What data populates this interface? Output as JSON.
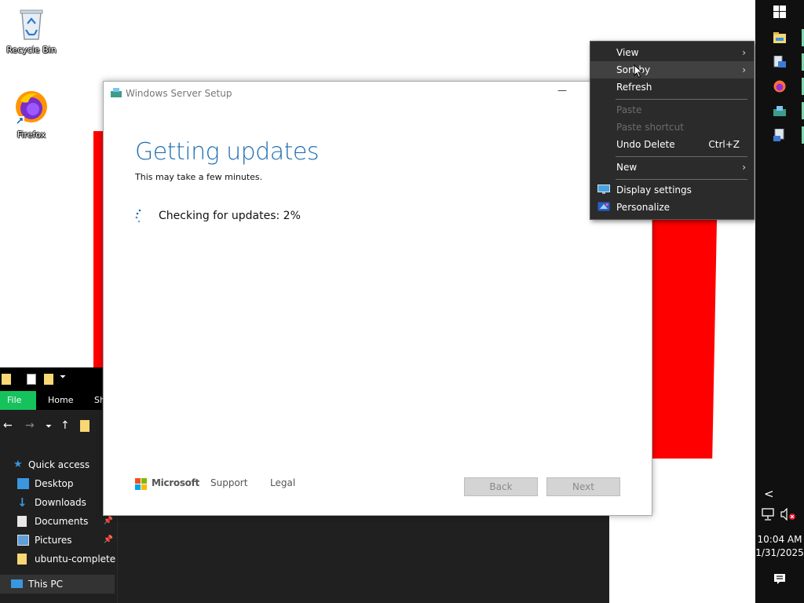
{
  "desktop": {
    "icons": [
      {
        "label": "Recycle Bin",
        "icon": "recycle-bin-icon"
      },
      {
        "label": "Firefox",
        "icon": "firefox-icon"
      }
    ]
  },
  "explorer": {
    "ribbon_tabs": [
      "File",
      "Home",
      "Sh"
    ],
    "nav": {
      "quick_access": "Quick access",
      "items": [
        {
          "label": "Desktop",
          "icon": "desktop-folder-icon",
          "pinned": false
        },
        {
          "label": "Downloads",
          "icon": "downloads-icon",
          "pinned": false
        },
        {
          "label": "Documents",
          "icon": "documents-icon",
          "pinned": true
        },
        {
          "label": "Pictures",
          "icon": "pictures-icon",
          "pinned": true
        },
        {
          "label": "ubuntu-complete",
          "icon": "folder-icon",
          "pinned": false
        }
      ],
      "this_pc": "This PC"
    }
  },
  "setup": {
    "title": "Windows Server Setup",
    "minimize": "—",
    "heading": "Getting updates",
    "subtitle": "This may take a few minutes.",
    "progress_text": "Checking for updates: 2%",
    "progress_percent": 2,
    "brand": "Microsoft",
    "links": {
      "support": "Support",
      "legal": "Legal"
    },
    "buttons": {
      "back": "Back",
      "next": "Next"
    }
  },
  "context_menu": {
    "items": {
      "view": "View",
      "sort_by": "Sort by",
      "refresh": "Refresh",
      "paste": "Paste",
      "paste_shortcut": "Paste shortcut",
      "undo_delete": "Undo Delete",
      "undo_shortcut": "Ctrl+Z",
      "new": "New",
      "display_settings": "Display settings",
      "personalize": "Personalize"
    },
    "arrow": "›"
  },
  "taskbar": {
    "time": "10:04 AM",
    "date": "1/31/2025",
    "chevron": "<"
  },
  "colors": {
    "accent_blue": "#1f6fb5",
    "red_shape": "#ff0000",
    "file_tab_green": "#16c25c"
  }
}
